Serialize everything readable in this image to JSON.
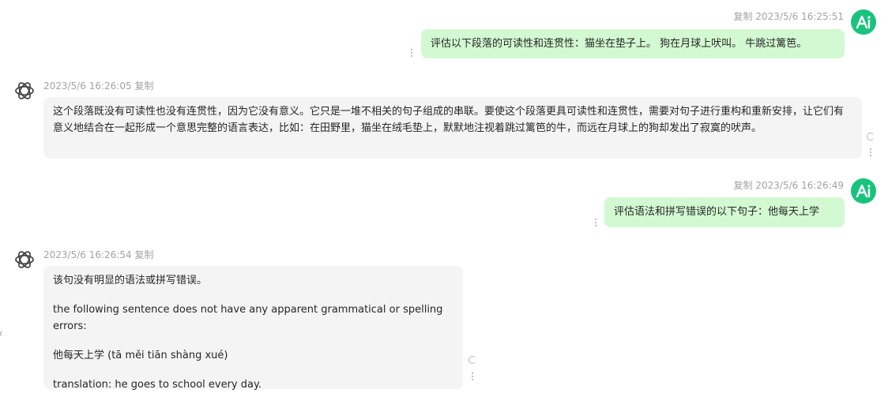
{
  "messages": [
    {
      "role": "user",
      "copy_label": "复制",
      "timestamp": "2023/5/6 16:25:51",
      "text": "评估以下段落的可读性和连贯性：猫坐在垫子上。 狗在月球上吠叫。 牛跳过篱笆。"
    },
    {
      "role": "assistant",
      "timestamp": "2023/5/6 16:26:05",
      "copy_label": "复制",
      "paragraphs": [
        "这个段落既没有可读性也没有连贯性，因为它没有意义。它只是一堆不相关的句子组成的串联。要使这个段落更具可读性和连贯性，需要对句子进行重构和重新安排，让它们有意义地结合在一起形成一个意思完整的语言表达，比如：在田野里，猫坐在绒毛垫上，默默地注视着跳过篱笆的牛，而远在月球上的狗却发出了寂寞的吠声。"
      ]
    },
    {
      "role": "user",
      "copy_label": "复制",
      "timestamp": "2023/5/6 16:26:49",
      "text": "评估语法和拼写错误的以下句子：他每天上学"
    },
    {
      "role": "assistant",
      "timestamp": "2023/5/6 16:26:54",
      "copy_label": "复制",
      "paragraphs": [
        "该句没有明显的语法或拼写错误。",
        "the following sentence does not have any apparent grammatical or spelling errors:",
        "他每天上学 (tā měi tiān shàng xué)",
        "translation: he goes to school every day."
      ]
    }
  ],
  "colors": {
    "user_bubble": "#d2f9d1",
    "bot_bubble": "#f4f4f5",
    "avatar_green": "#19c37d",
    "meta_text": "#a3a3a3"
  },
  "icons": {
    "user_avatar": "ai-logo-icon",
    "assistant_avatar": "openai-logo-icon",
    "more": "vertical-dots-icon",
    "regenerate": "refresh-icon",
    "collapse": "chevron-left-icon"
  }
}
